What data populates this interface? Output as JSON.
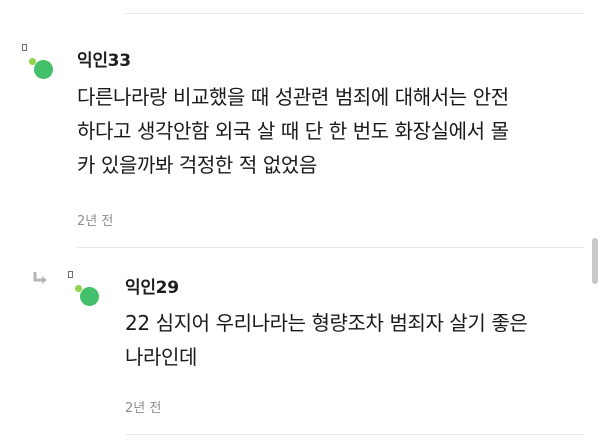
{
  "colors": {
    "avatar_small_dot": "#8fd44a",
    "avatar_big_dot": "#44c06a",
    "text": "#1a1a1a",
    "muted": "#8e8e8e",
    "divider": "#e9e9e9"
  },
  "comments": [
    {
      "author": "익인33",
      "lines": [
        "다른나라랑 비교했을 때 성관련 범죄에 대해서는 안전",
        "하다고 생각안함 외국 살 때 단 한 번도 화장실에서 몰",
        "카 있을까봐 걱정한 적 없었음"
      ],
      "time": "2년 전"
    },
    {
      "author": "익인29",
      "is_reply": true,
      "lines": [
        "22 심지어 우리나라는 형량조차 범죄자 살기 좋은",
        "나라인데"
      ],
      "time": "2년 전"
    }
  ],
  "icons": {
    "reply": "reply-arrow-icon",
    "avatar": "avatar-icon"
  }
}
